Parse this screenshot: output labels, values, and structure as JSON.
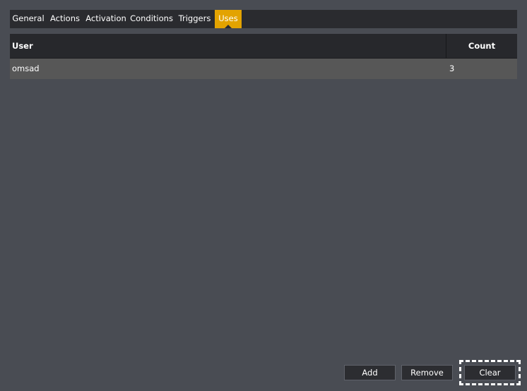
{
  "tabs": [
    {
      "label": "General"
    },
    {
      "label": "Actions"
    },
    {
      "label": "Activation"
    },
    {
      "label": "Conditions"
    },
    {
      "label": "Triggers"
    },
    {
      "label": "Uses",
      "active": true
    }
  ],
  "table": {
    "columns": [
      "User",
      "Count"
    ],
    "rows": [
      {
        "user": "omsad",
        "count": "3"
      }
    ]
  },
  "buttons": {
    "add": "Add",
    "remove": "Remove",
    "clear": "Clear"
  },
  "colors": {
    "background": "#494c53",
    "tabbar": "#2a2b2f",
    "active_tab": "#e3a300",
    "row_background": "#575757",
    "button_background": "#2c2d31"
  }
}
